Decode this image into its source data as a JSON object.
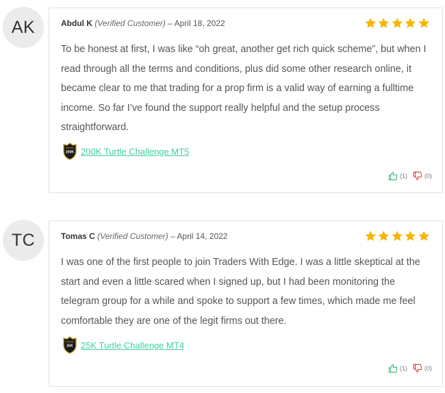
{
  "reviews": [
    {
      "initials": "AK",
      "name": "Abdul K",
      "verified": "(Verified Customer)",
      "date": "– April 18, 2022",
      "rating": 5,
      "text": "To be honest at first, I was like “oh great, another get rich quick scheme”, but when I read through all the terms and conditions, plus did some other research online, it became clear to me that trading for a prop firm is a valid way of earning a fulltime income. So far I’ve found the support really helpful and the setup process straightforward.",
      "product": "200K Turtle Challenge MT5",
      "badge_text": "200K",
      "upvotes": "(1)",
      "downvotes": "(0)"
    },
    {
      "initials": "TC",
      "name": "Tomas C",
      "verified": "(Verified Customer)",
      "date": "– April 14, 2022",
      "rating": 5,
      "text": "I was one of the first people to join Traders With Edge. I was a little skeptical at the start and even a little scared when I signed up, but I had been monitoring the telegram group for a while and spoke to support a few times, which made me feel comfortable they are one of the legit firms out there.",
      "product": "25K Turtle Challenge MT4",
      "badge_text": "25K",
      "upvotes": "(1)",
      "downvotes": "(0)"
    }
  ],
  "colors": {
    "star": "#f7b500",
    "link": "#3ecfa3",
    "thumb_up": "#2db36f",
    "thumb_down": "#d9363e"
  },
  "icons": {
    "star": "star-icon",
    "thumb_up": "thumbs-up-icon",
    "thumb_down": "thumbs-down-icon",
    "badge": "shield-badge-icon"
  }
}
